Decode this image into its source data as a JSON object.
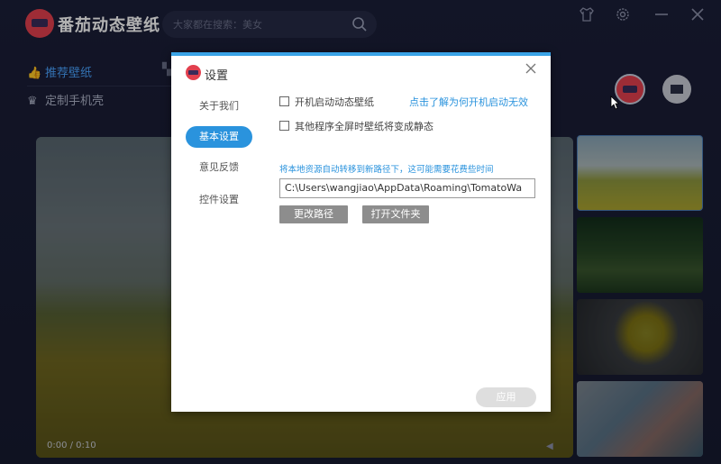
{
  "app": {
    "title": "番茄动态壁纸",
    "search_placeholder": "大家都在搜索：美女",
    "nav": [
      {
        "label": "推荐壁纸",
        "active": true
      },
      {
        "label": "定制手机壳",
        "active": false
      }
    ],
    "player": {
      "time": "0:00 / 0:10"
    }
  },
  "dialog": {
    "title": "设置",
    "sidebar": [
      {
        "label": "关于我们",
        "active": false
      },
      {
        "label": "基本设置",
        "active": true
      },
      {
        "label": "意见反馈",
        "active": false
      },
      {
        "label": "控件设置",
        "active": false
      }
    ],
    "options": {
      "autostart_label": "开机启动动态壁纸",
      "autostart_checked": false,
      "autostart_help_link": "点击了解为何开机启动无效",
      "fullscreen_static_label": "其他程序全屏时壁纸将变成静态",
      "fullscreen_static_checked": false
    },
    "storage": {
      "hint": "将本地资源自动转移到新路径下，这可能需要花费些时间",
      "path": "C:\\Users\\wangjiao\\AppData\\Roaming\\TomatoWa",
      "change_path_label": "更改路径",
      "open_folder_label": "打开文件夹"
    },
    "apply_label": "应用"
  },
  "colors": {
    "accent": "#2a93dd",
    "dialog_top_bar": "#3aa3e6",
    "brand_red": "#e2404e",
    "app_bg": "#1b1f38"
  },
  "icons": [
    "search-icon",
    "shirt-icon",
    "gear-icon",
    "minimize-icon",
    "close-icon",
    "thumbs-up-icon",
    "grid-icon",
    "crown-icon",
    "mail-icon",
    "volume-icon"
  ]
}
